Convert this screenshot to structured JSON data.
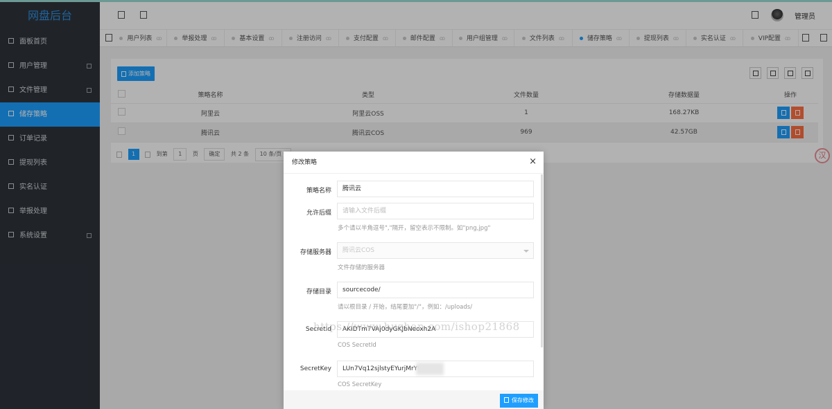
{
  "app": {
    "logo": "网盘后台",
    "admin_name": "管理员"
  },
  "sidebar": {
    "items": [
      {
        "label": "面板首页",
        "has_arrow": false
      },
      {
        "label": "用户管理",
        "has_arrow": true
      },
      {
        "label": "文件管理",
        "has_arrow": true
      },
      {
        "label": "储存策略",
        "has_arrow": false,
        "active": true
      },
      {
        "label": "订单记录",
        "has_arrow": false
      },
      {
        "label": "提现列表",
        "has_arrow": false
      },
      {
        "label": "实名认证",
        "has_arrow": false
      },
      {
        "label": "举报处理",
        "has_arrow": false
      },
      {
        "label": "系统设置",
        "has_arrow": true
      }
    ]
  },
  "tabs": [
    {
      "label": "用户列表"
    },
    {
      "label": "举报处理"
    },
    {
      "label": "基本设置"
    },
    {
      "label": "注册访问"
    },
    {
      "label": "支付配置"
    },
    {
      "label": "邮件配置"
    },
    {
      "label": "用户组管理"
    },
    {
      "label": "文件列表"
    },
    {
      "label": "储存策略",
      "active": true
    },
    {
      "label": "提现列表"
    },
    {
      "label": "实名认证"
    },
    {
      "label": "VIP配置"
    }
  ],
  "toolbar": {
    "add_label": "添加策略"
  },
  "table": {
    "headers": [
      "策略名称",
      "类型",
      "文件数量",
      "存储数据量",
      "操作"
    ],
    "rows": [
      {
        "name": "阿里云",
        "type": "阿里云OSS",
        "count": "1",
        "size": "168.27KB"
      },
      {
        "name": "腾讯云",
        "type": "腾讯云COS",
        "count": "969",
        "size": "42.57GB"
      }
    ]
  },
  "pager": {
    "current": "1",
    "goto_label": "到第",
    "page_input": "1",
    "page_unit": "页",
    "confirm": "确定",
    "total": "共 2 条",
    "per_page": "10 条/页"
  },
  "side_badge": "汉",
  "modal": {
    "title": "修改策略",
    "close": "×",
    "fields": {
      "name_label": "策略名称",
      "name_value": "腾讯云",
      "suffix_label": "允许后缀",
      "suffix_placeholder": "请输入文件后缀",
      "suffix_hint": "多个请以半角逗号\",\"隔开，留空表示不限制。如\"png,jpg\"",
      "server_label": "存储服务器",
      "server_value": "腾讯云COS",
      "server_hint": "文件存储的服务器",
      "dir_label": "存储目录",
      "dir_value": "sourcecode/",
      "dir_hint": "请以根目录 / 开始，结尾要加\"/\"，例如：/uploads/",
      "secretid_label": "SecretId",
      "secretid_value": "AKIDTm7VAj0dyGKJbNeoxh2A",
      "secretid_hint": "COS SecretId",
      "secretkey_label": "SecretKey",
      "secretkey_value": "LUn7Vq12sjlstyEYurjMrY92",
      "secretkey_hint": "COS SecretKey"
    },
    "save_label": "保存修改"
  },
  "watermark": "https://www.huzhan.com/ishop21868"
}
